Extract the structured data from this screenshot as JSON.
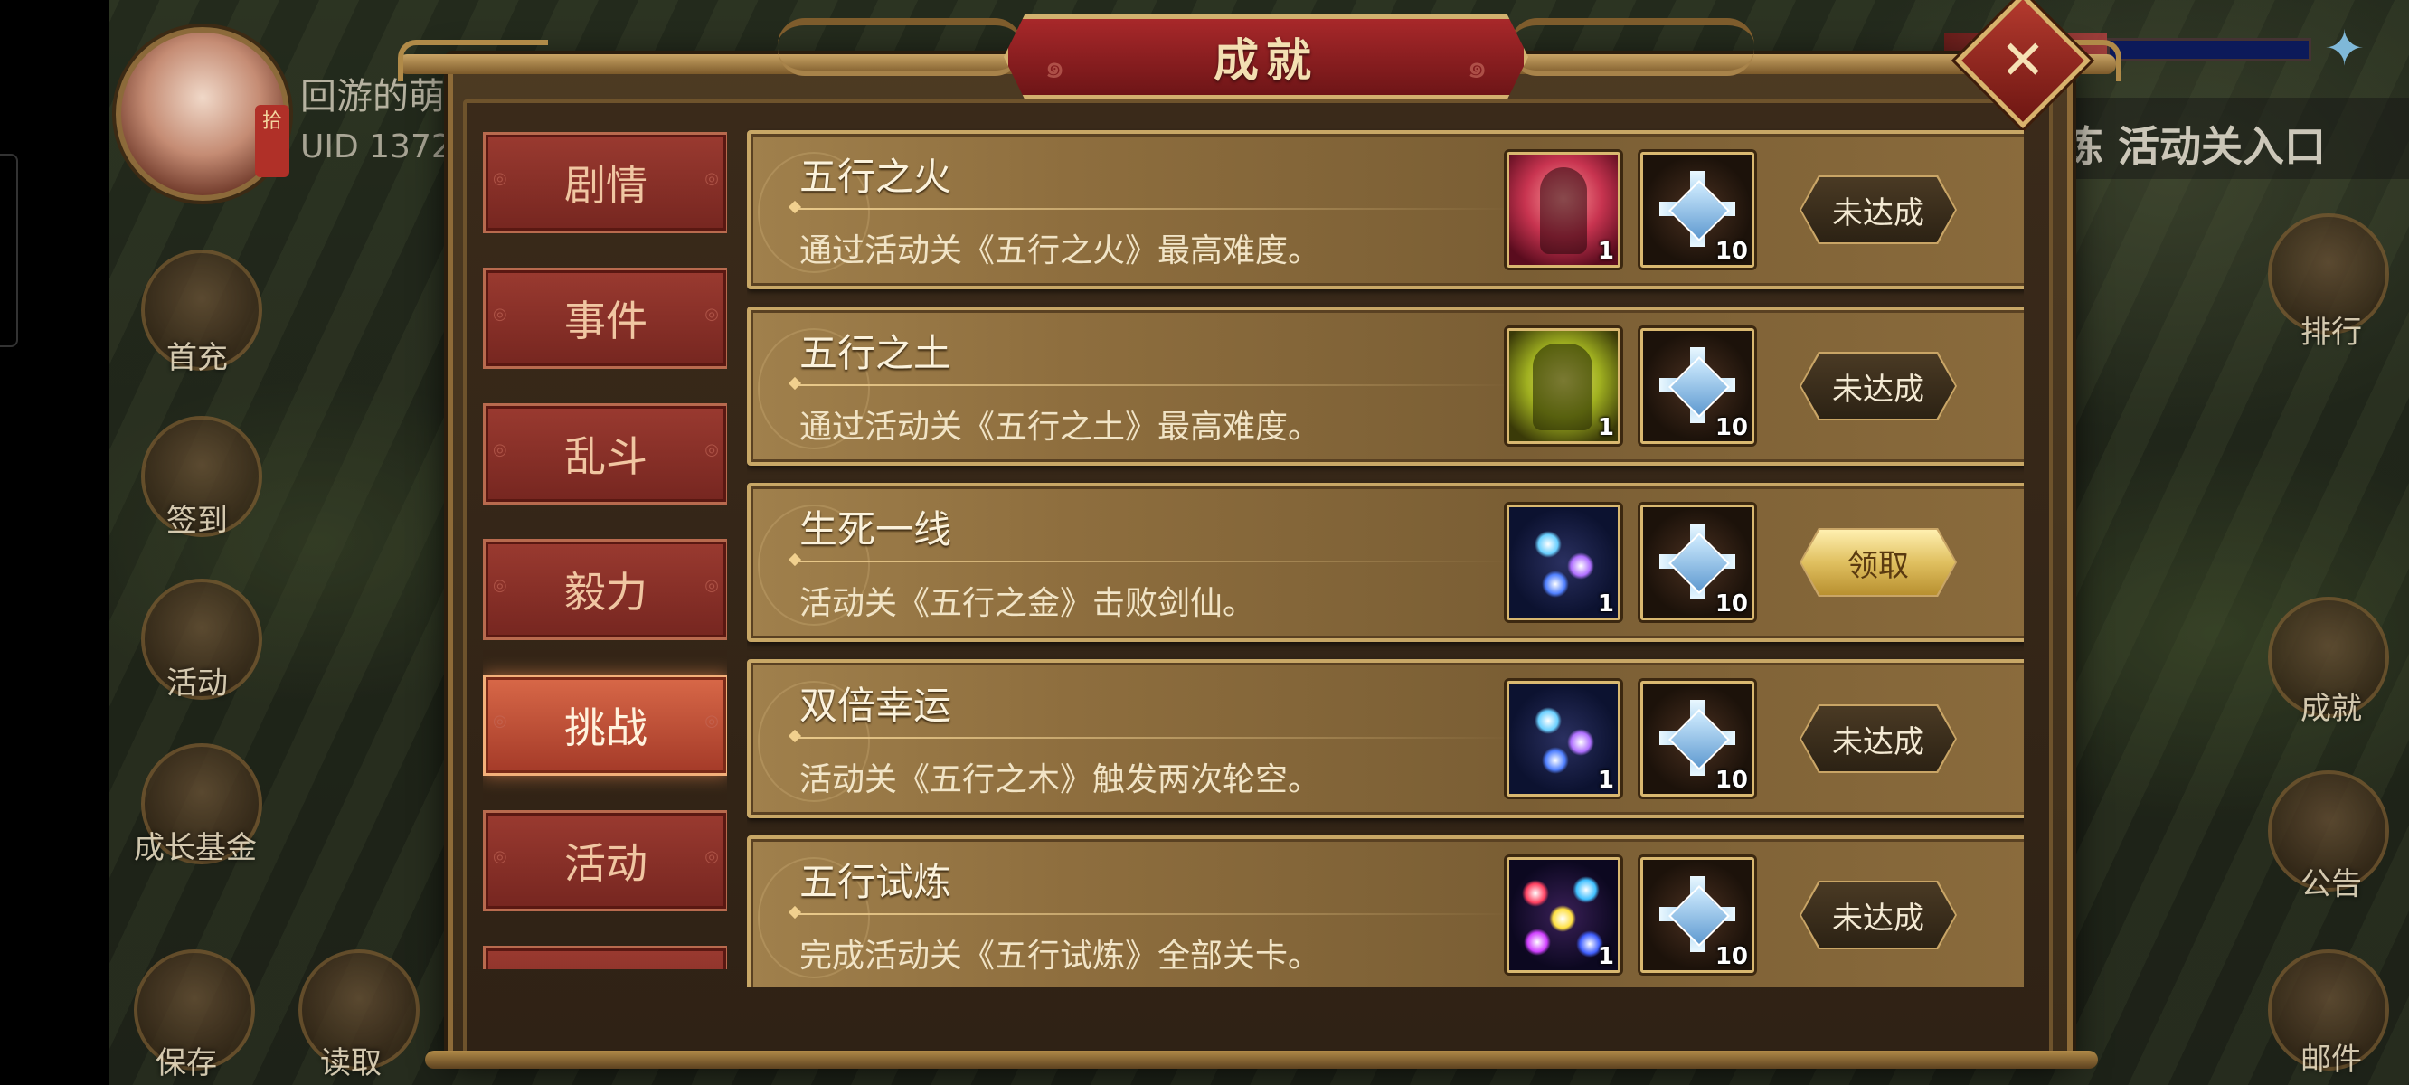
{
  "hud": {
    "player_name": "回游的萌",
    "uid": "UID  1372",
    "top_right_text": "炼 活动关入口",
    "left_buttons": [
      "首充",
      "签到",
      "活动",
      "成长基金"
    ],
    "bottom_buttons": [
      "保存",
      "读取"
    ],
    "right_buttons": [
      "排行",
      "成就",
      "公告",
      "邮件"
    ]
  },
  "modal": {
    "title": "成就",
    "close_icon": "close-x-icon"
  },
  "tabs": [
    {
      "label": "剧情",
      "active": false
    },
    {
      "label": "事件",
      "active": false
    },
    {
      "label": "乱斗",
      "active": false
    },
    {
      "label": "毅力",
      "active": false
    },
    {
      "label": "挑战",
      "active": true
    },
    {
      "label": "活动",
      "active": false
    }
  ],
  "achievements": [
    {
      "title": "五行之火",
      "description": "通过活动关《五行之火》最高难度。",
      "rewards": [
        {
          "icon": "fire-warrior-icon",
          "qty": "1"
        },
        {
          "icon": "ice-crystal-icon",
          "qty": "10"
        }
      ],
      "status": "未达成"
    },
    {
      "title": "五行之土",
      "description": "通过活动关《五行之土》最高难度。",
      "rewards": [
        {
          "icon": "earth-warrior-icon",
          "qty": "1"
        },
        {
          "icon": "ice-crystal-icon",
          "qty": "10"
        }
      ],
      "status": "未达成"
    },
    {
      "title": "生死一线",
      "description": "活动关《五行之金》击败剑仙。",
      "rewards": [
        {
          "icon": "spirit-orbs-icon",
          "qty": "1"
        },
        {
          "icon": "ice-crystal-icon",
          "qty": "10"
        }
      ],
      "status": "领取"
    },
    {
      "title": "双倍幸运",
      "description": "活动关《五行之木》触发两次轮空。",
      "rewards": [
        {
          "icon": "spirit-orbs-icon",
          "qty": "1"
        },
        {
          "icon": "ice-crystal-icon",
          "qty": "10"
        }
      ],
      "status": "未达成"
    },
    {
      "title": "五行试炼",
      "description": "完成活动关《五行试炼》全部关卡。",
      "rewards": [
        {
          "icon": "five-elements-orbs-icon",
          "qty": "1"
        },
        {
          "icon": "ice-crystal-icon",
          "qty": "10"
        }
      ],
      "status": "未达成"
    }
  ],
  "colors": {
    "tab_active": "#d86848",
    "tab_inactive": "#9a3a30",
    "claim_button": "#e0c060",
    "row_border": "#c8a766"
  }
}
